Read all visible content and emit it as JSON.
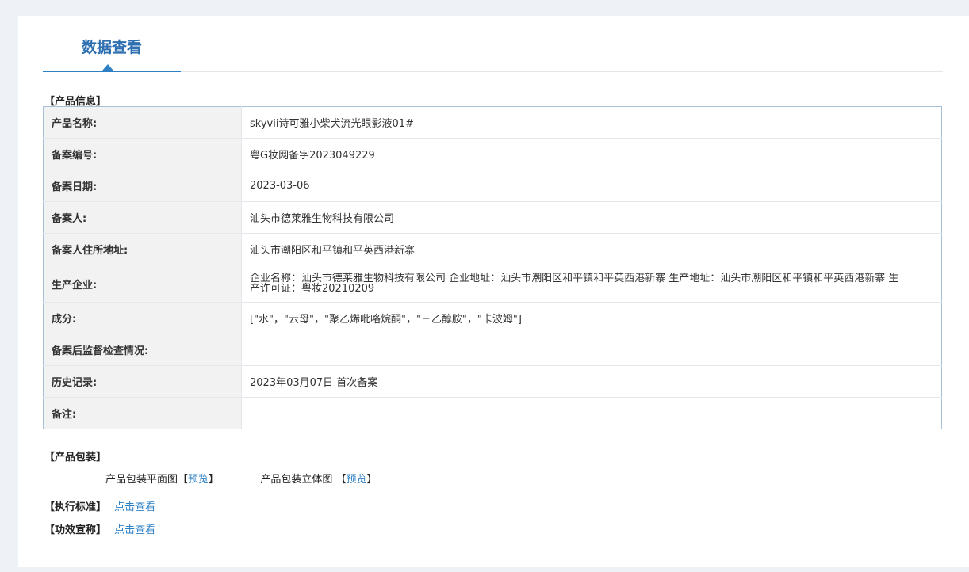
{
  "header": {
    "title": "数据查看"
  },
  "product_info": {
    "section_label": "【产品信息】",
    "rows": [
      {
        "label": "产品名称:",
        "value": "skyvii诗可雅小柴犬流光眼影液01#"
      },
      {
        "label": "备案编号:",
        "value": "粤G妆网备字2023049229"
      },
      {
        "label": "备案日期:",
        "value": "2023-03-06"
      },
      {
        "label": "备案人:",
        "value": "汕头市德莱雅生物科技有限公司"
      },
      {
        "label": "备案人住所地址:",
        "value": "汕头市潮阳区和平镇和平英西港新寨"
      },
      {
        "label": "生产企业:",
        "value": "企业名称：汕头市德莱雅生物科技有限公司 企业地址：汕头市潮阳区和平镇和平英西港新寨 生产地址：汕头市潮阳区和平镇和平英西港新寨 生产许可证：粤妆20210209"
      },
      {
        "label": "成分:",
        "value": "[\"水\"，\"云母\"，\"聚乙烯吡咯烷酮\"，\"三乙醇胺\"，\"卡波姆\"]"
      },
      {
        "label": "备案后监督检查情况:",
        "value": ""
      },
      {
        "label": "历史记录:",
        "value": "2023年03月07日 首次备案"
      },
      {
        "label": "备注:",
        "value": ""
      }
    ]
  },
  "packaging": {
    "section_label": "【产品包装】",
    "flat_label": "产品包装平面图",
    "solid_label": "产品包装立体图",
    "bracket_open": "【",
    "bracket_close": "】",
    "preview_link": "预览"
  },
  "standard": {
    "label": "【执行标准】",
    "link": "点击查看"
  },
  "efficacy": {
    "label": "【功效宣称】",
    "link": "点击查看"
  },
  "colors": {
    "accent": "#2e80c5",
    "title": "#2d6fb1",
    "table_border": "#a9c0db",
    "key_bg": "#f2f2f2"
  }
}
